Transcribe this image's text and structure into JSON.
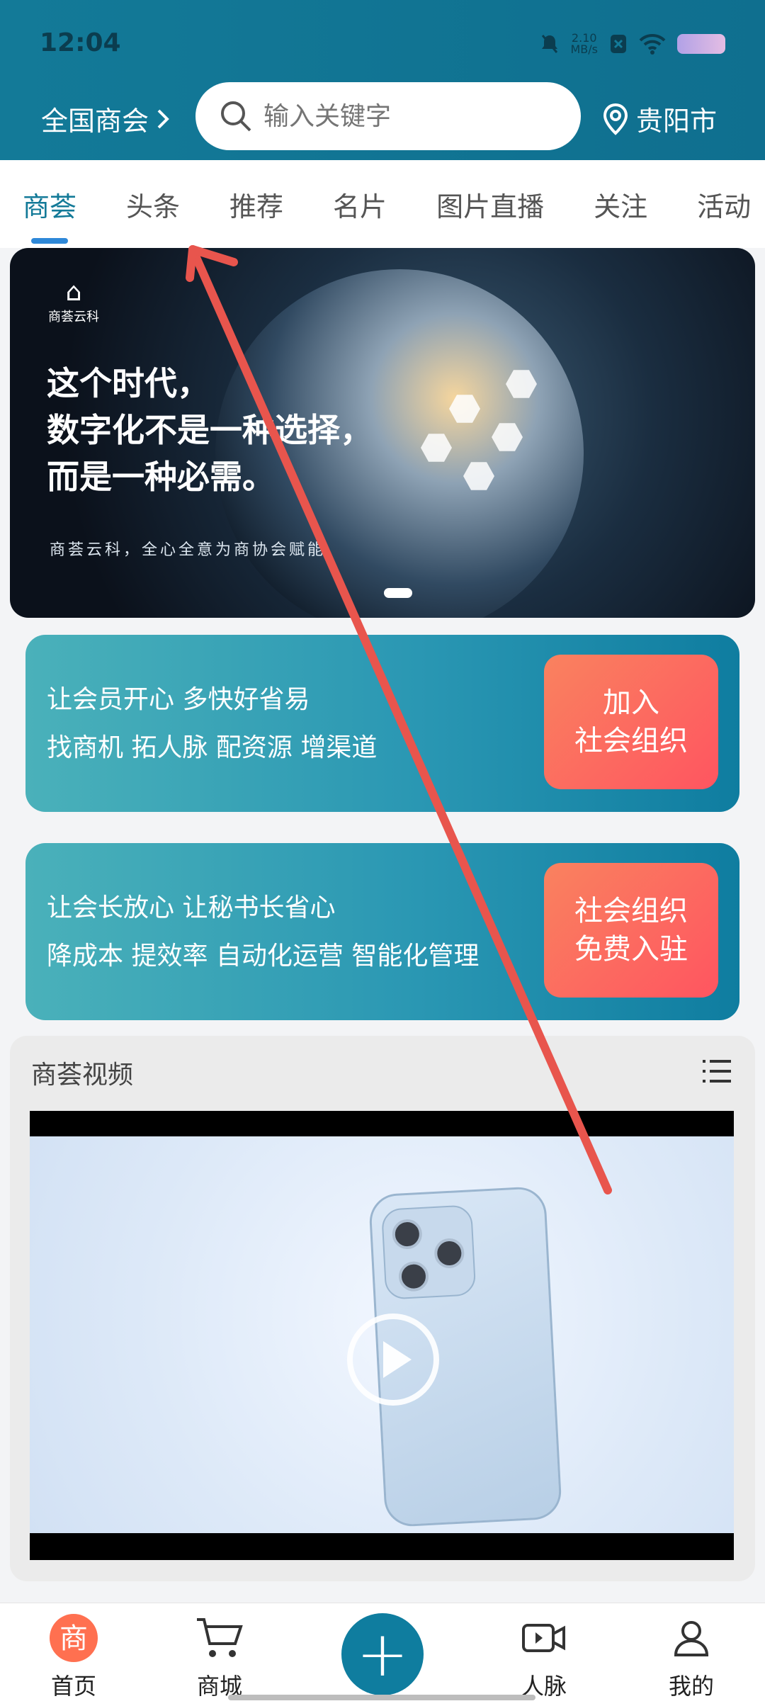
{
  "status_bar": {
    "time": "12:04",
    "net_speed_value": "2.10",
    "net_speed_unit": "MB/s"
  },
  "header": {
    "region": "全国商会",
    "search_placeholder": "输入关键字",
    "city": "贵阳市"
  },
  "tabs": [
    "商荟",
    "头条",
    "推荐",
    "名片",
    "图片直播",
    "关注",
    "活动"
  ],
  "banner": {
    "logo_text": "商荟云科",
    "headline": [
      "这个时代，",
      "数字化不是一种选择，",
      "而是一种必需。"
    ],
    "subline": "商荟云科，全心全意为商协会赋能"
  },
  "promo_cards": [
    {
      "line1": "让会员开心 多快好省易",
      "line2": "找商机 拓人脉 配资源 增渠道",
      "cta_line1": "加入",
      "cta_line2": "社会组织"
    },
    {
      "line1": "让会长放心 让秘书长省心",
      "line2": "降成本 提效率 自动化运营 智能化管理",
      "cta_line1": "社会组织",
      "cta_line2": "免费入驻"
    }
  ],
  "video_section": {
    "title": "商荟视频"
  },
  "bottom_nav": [
    {
      "label": "首页"
    },
    {
      "label": "商城"
    },
    {
      "label": "人脉"
    },
    {
      "label": "我的"
    }
  ],
  "colors": {
    "header_bg": "#137a98",
    "accent_blue": "#2e88d8",
    "cta_coral": "#ff5a60",
    "annotation_arrow": "#e8554d"
  }
}
